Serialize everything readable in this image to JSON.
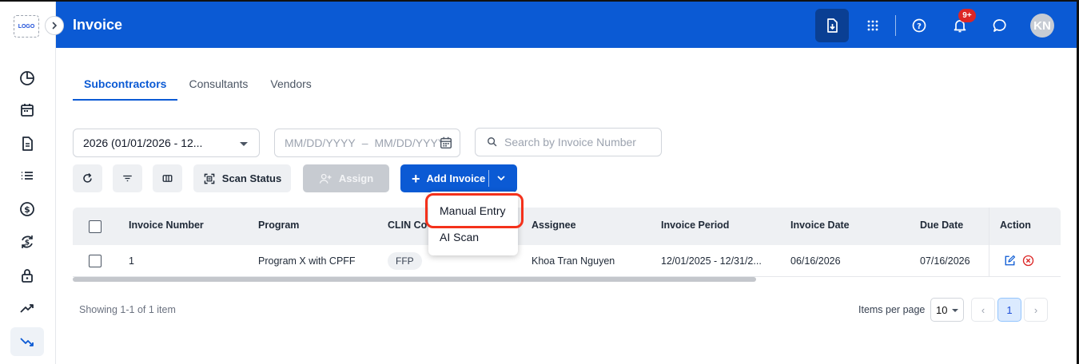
{
  "app": {
    "logo_text": "LOGO",
    "title": "Invoice",
    "avatar_initials": "KN",
    "notification_badge": "9+"
  },
  "colors": {
    "primary": "#0b5ad4",
    "header_bg": "#0b5ad4",
    "highlight": "#f4311b",
    "danger": "#dc2626"
  },
  "sidebar": {
    "icons": [
      "dashboard-icon",
      "calendar-icon",
      "document-icon",
      "list-icon",
      "dollar-icon",
      "dollar-cycle-icon",
      "lock-icon",
      "trending-up-icon",
      "trending-down-icon"
    ],
    "active": "trending-down-icon"
  },
  "tabs": [
    {
      "label": "Subcontractors",
      "active": true
    },
    {
      "label": "Consultants",
      "active": false
    },
    {
      "label": "Vendors",
      "active": false
    }
  ],
  "filters": {
    "year_value": "2026 (01/01/2026 - 12...",
    "date_start_placeholder": "MM/DD/YYYY",
    "date_separator": "–",
    "date_end_placeholder": "MM/DD/YYYY",
    "search_placeholder": "Search by Invoice Number"
  },
  "toolbar": {
    "scan_status_label": "Scan Status",
    "assign_label": "Assign",
    "add_invoice_label": "Add Invoice"
  },
  "dropdown": {
    "items": [
      "Manual Entry",
      "AI Scan"
    ],
    "highlighted": "Manual Entry"
  },
  "table": {
    "columns": [
      "Invoice Number",
      "Program",
      "CLIN Co",
      "Assignee",
      "Invoice Period",
      "Invoice Date",
      "Due Date",
      "Action"
    ],
    "rows": [
      {
        "invoice_number": "1",
        "program": "Program X with CPFF",
        "clin": "FFP",
        "assignee": "Khoa Tran Nguyen",
        "invoice_period": "12/01/2025 - 12/31/2...",
        "invoice_date": "06/16/2026",
        "due_date": "07/16/2026"
      }
    ]
  },
  "footer": {
    "showing": "Showing 1-1 of 1 item",
    "items_per_page_label": "Items per page",
    "items_per_page_value": "10",
    "current_page": "1",
    "prev_symbol": "‹",
    "next_symbol": "›"
  }
}
